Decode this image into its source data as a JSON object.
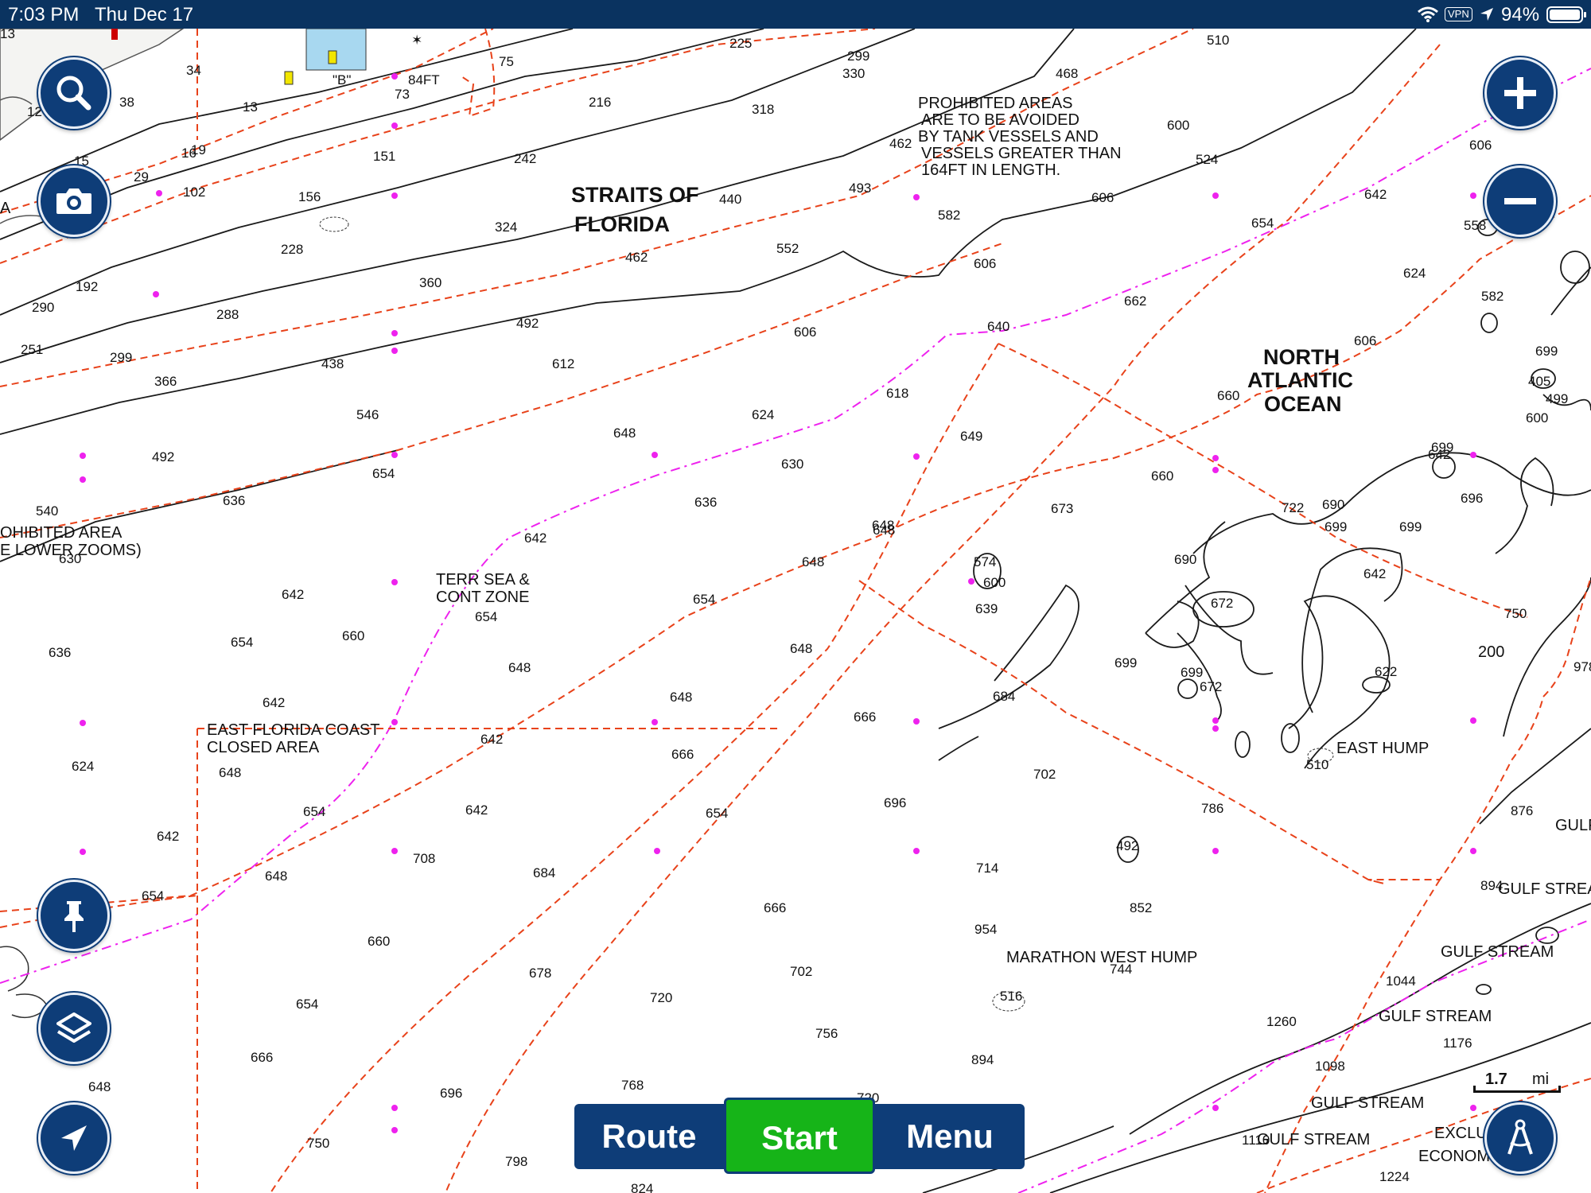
{
  "status_bar": {
    "time": "7:03 PM",
    "date": "Thu Dec 17",
    "vpn": "VPN",
    "battery": "94%"
  },
  "map": {
    "labels": {
      "straits1": "STRAITS OF",
      "straits2": "FLORIDA",
      "nao1": "NORTH",
      "nao2": "ATLANTIC",
      "nao3": "OCEAN",
      "prohibited1": "PROHIBITED AREAS",
      "prohibited2": "ARE TO BE AVOIDED",
      "prohibited3": "BY TANK VESSELS AND",
      "prohibited4": "VESSELS GREATER THAN",
      "prohibited5": "164FT IN LENGTH.",
      "prohib_area1": "OHIBITED AREA",
      "prohib_area2": "E LOWER ZOOMS)",
      "terr1": "TERR SEA &",
      "terr2": "CONT ZONE",
      "efc1": "EAST FLORIDA COAST",
      "efc2": "CLOSED AREA",
      "east_hump": "EAST HUMP",
      "marathon": "MARATHON WEST HUMP",
      "gulf1": "GULF",
      "gulf2": "GULF STREA",
      "gulf3": "GULF STREAM",
      "gulf4": "GULF STREAM",
      "gulf5": "GULF STREAM",
      "gulf6": "GULF STREAM",
      "excl1": "EXCLU",
      "excl2": "ECONOMI",
      "b_label": "\"B\"",
      "ft84": "84FT",
      "a_edge": "A",
      "n200": "200"
    },
    "soundings": {
      "s1": "13",
      "s2": "34",
      "s3": "38",
      "s4": "12",
      "s5": "13",
      "s6": "19",
      "s7": "29",
      "s8": "15",
      "s9": "16",
      "s10": "102",
      "s11": "151",
      "s12": "156",
      "s13": "228",
      "s14": "192",
      "s15": "290",
      "s16": "251",
      "s17": "288",
      "s18": "299",
      "s19": "366",
      "s20": "360",
      "s21": "438",
      "s22": "492",
      "s23": "546",
      "s24": "492",
      "s25": "540",
      "s26": "636",
      "s27": "654",
      "s28": "630",
      "s29": "75",
      "s30": "73",
      "s31": "225",
      "s32": "216",
      "s33": "242",
      "s34": "324",
      "s35": "440",
      "s36": "462",
      "s37": "462",
      "s38": "552",
      "s39": "612",
      "s40": "299",
      "s41": "330",
      "s42": "318",
      "s43": "468",
      "s44": "493",
      "s45": "582",
      "s46": "606",
      "s47": "606",
      "s48": "606",
      "s49": "640",
      "s50": "618",
      "s51": "624",
      "s52": "648",
      "s53": "630",
      "s54": "649",
      "s55": "636",
      "s56": "648",
      "s57": "642",
      "s58": "673",
      "s59": "660",
      "s60": "510",
      "s61": "600",
      "s62": "524",
      "s63": "606",
      "s64": "642",
      "s65": "654",
      "s66": "558",
      "s67": "624",
      "s68": "582",
      "s69": "662",
      "s70": "606",
      "s71": "699",
      "s72": "405",
      "s73": "499",
      "s74": "600",
      "s75": "642",
      "s76": "699",
      "s77": "696",
      "s78": "660",
      "s79": "722",
      "s80": "690",
      "s81": "699",
      "s82": "699",
      "s83": "642",
      "s84": "690",
      "s85": "672",
      "s86": "574",
      "s87": "600",
      "s88": "639",
      "s89": "648",
      "s90": "654",
      "s91": "648",
      "s92": "648",
      "s93": "666",
      "s94": "684",
      "s95": "699",
      "s96": "699",
      "s97": "672",
      "s98": "622",
      "s99": "750",
      "s100": "978",
      "s101": "642",
      "s102": "654",
      "s103": "636",
      "s104": "660",
      "s105": "654",
      "s106": "648",
      "s107": "648",
      "s108": "642",
      "s109": "642",
      "s110": "624",
      "s111": "648",
      "s112": "654",
      "s113": "642",
      "s114": "666",
      "s115": "654",
      "s116": "642",
      "s117": "708",
      "s118": "648",
      "s119": "684",
      "s120": "654",
      "s121": "696",
      "s122": "702",
      "s123": "786",
      "s124": "510",
      "s125": "876",
      "s126": "894",
      "s127": "714",
      "s128": "492",
      "s129": "852",
      "s130": "666",
      "s131": "660",
      "s132": "654",
      "s133": "678",
      "s134": "702",
      "s135": "720",
      "s136": "954",
      "s137": "744",
      "s138": "516",
      "s139": "1044",
      "s140": "1260",
      "s141": "1176",
      "s142": "756",
      "s143": "894",
      "s144": "666",
      "s145": "648",
      "s146": "696",
      "s147": "768",
      "s148": "720",
      "s149": "750",
      "s150": "798",
      "s151": "1098",
      "s152": "1110",
      "s153": "1224",
      "s154": "824"
    }
  },
  "controls": {
    "search": "search",
    "camera": "camera",
    "zoom_in": "plus",
    "zoom_out": "minus",
    "pin": "pushpin",
    "layers": "layers",
    "locate": "navigation-arrow",
    "compass": "compass"
  },
  "nav": {
    "route": "Route",
    "start": "Start",
    "menu": "Menu"
  },
  "scale": {
    "value": "1.7",
    "unit": "mi"
  }
}
